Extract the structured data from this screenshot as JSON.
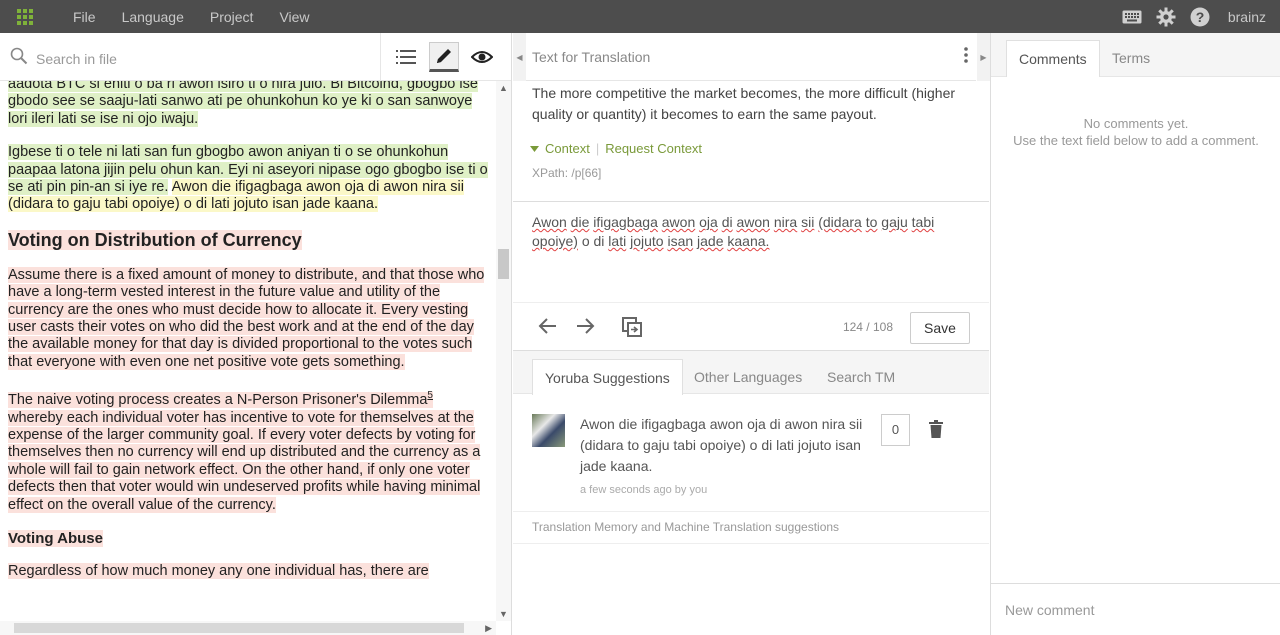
{
  "menu": {
    "file": "File",
    "language": "Language",
    "project": "Project",
    "view": "View"
  },
  "user": {
    "name": "brainz"
  },
  "search": {
    "placeholder": "Search in file"
  },
  "document": {
    "p1_green": "aadota BTC si eniti o ba ri awon isiro ti o nira julo. Bi Bitcoind, gbogbo ise gbodo see se saaju-lati sanwo ati pe ohunkohun ko ye ki o san sanwoye lori ileri lati se ise ni ojo iwaju.",
    "p2_green": "Igbese ti o tele ni lati san fun gbogbo awon aniyan ti o se ohunkohun paapaa latona jijin pelu ohun kan. Eyi ni aseyori nipase ogo gbogbo ise ti o se ati pin pin-an si iye re.",
    "p2_yellow": "Awon die ifigagbaga awon oja di awon nira sii (didara to gaju tabi opoiye) o di lati jojuto isan jade kaana.",
    "heading1": "Voting on Distribution of Currency",
    "p3": "Assume there is a fixed amount of money to distribute, and that those who have a long-term vested interest in the future value and utility of the currency are the ones who must decide how to allocate it. Every vesting user casts their votes on who did the best work and at the end of the day the available money for that day is divided proportional to the votes such that everyone with even one net positive vote gets something.",
    "p4a": "The naive voting process creates a N-Person Prisoner's Dilemma",
    "p4_sup": "5",
    "p4b": "whereby each individual voter has incentive to vote for themselves at the expense of the larger community goal. If every voter defects by voting for themselves then no currency will end up distributed and the currency as a whole will fail to gain network effect. On the other hand, if only one voter defects then that voter would win undeserved profits while having minimal effect on the overall value of the currency.",
    "heading2": "Voting Abuse",
    "p5": "Regardless of how much money any one individual has, there are"
  },
  "translation": {
    "header": "Text for Translation",
    "source": "The more competitive the market becomes, the more difficult (higher quality or quantity) it becomes to earn the same payout.",
    "context_label": "Context",
    "request_context": "Request Context",
    "xpath": "XPath: /p[66]",
    "target_words": [
      "Awon",
      "die",
      "ifigagbaga",
      "awon",
      "oja",
      "di",
      "awon",
      "nira",
      "sii",
      "(didara",
      "to",
      "gaju",
      "tabi",
      "opoiye)",
      "o",
      "di",
      "lati",
      "jojuto",
      "isan",
      "jade",
      "kaana."
    ],
    "count": "124 / 108",
    "save": "Save"
  },
  "suggestions": {
    "tabs": [
      "Yoruba Suggestions",
      "Other Languages",
      "Search TM"
    ],
    "item_text": "Awon die ifigagbaga awon oja di awon nira sii (didara to gaju tabi opoiye) o di lati jojuto isan jade kaana.",
    "item_meta": "a few seconds ago by you",
    "votes": "0",
    "tm_label": "Translation Memory and Machine Translation suggestions"
  },
  "comments": {
    "tabs": [
      "Comments",
      "Terms"
    ],
    "empty_line1": "No comments yet.",
    "empty_line2": "Use the text field below to add a comment.",
    "new_placeholder": "New comment"
  },
  "colors": {
    "topbar": "#4d4d4d",
    "accent_green": "#7fb23a",
    "highlight_green": "#dff0c6",
    "highlight_yellow": "#fbf8c8",
    "highlight_red": "#fbe1dc"
  }
}
